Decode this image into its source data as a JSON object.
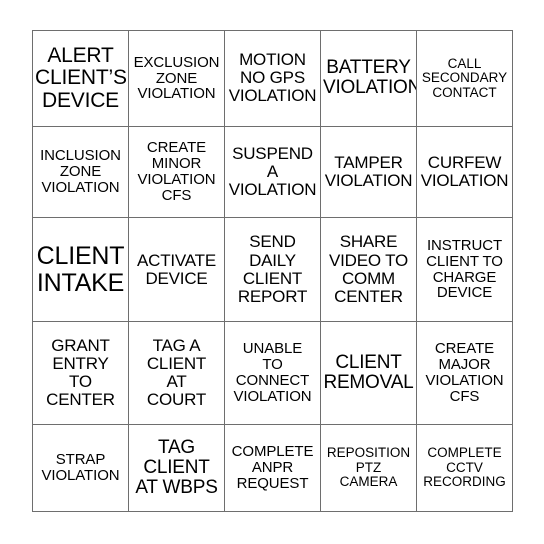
{
  "card": {
    "type": "bingo-card",
    "rows": 5,
    "columns": 5,
    "border_color": "#6e6e6e",
    "background_color": "#ffffff",
    "text_color": "#000000",
    "cells": [
      [
        {
          "text": "ALERT\nCLIENT’S\nDEVICE",
          "size": "xl"
        },
        {
          "text": "EXCLUSION\nZONE\nVIOLATION",
          "size": "s"
        },
        {
          "text": "MOTION\nNO GPS\nVIOLATION",
          "size": "m"
        },
        {
          "text": "BATTERY\nVIOLATION",
          "size": "l"
        },
        {
          "text": "CALL\nSECONDARY\nCONTACT",
          "size": "xs"
        }
      ],
      [
        {
          "text": "INCLUSION\nZONE\nVIOLATION",
          "size": "s"
        },
        {
          "text": "CREATE\nMINOR\nVIOLATION\nCFS",
          "size": "s"
        },
        {
          "text": "SUSPEND\nA\nVIOLATION",
          "size": "m"
        },
        {
          "text": "TAMPER\nVIOLATION",
          "size": "m"
        },
        {
          "text": "CURFEW\nVIOLATION",
          "size": "m"
        }
      ],
      [
        {
          "text": "CLIENT\nINTAKE",
          "size": "xxl"
        },
        {
          "text": "ACTIVATE\nDEVICE",
          "size": "m"
        },
        {
          "text": "SEND\nDAILY\nCLIENT\nREPORT",
          "size": "m"
        },
        {
          "text": "SHARE\nVIDEO TO\nCOMM\nCENTER",
          "size": "m"
        },
        {
          "text": "INSTRUCT\nCLIENT TO\nCHARGE\nDEVICE",
          "size": "s"
        }
      ],
      [
        {
          "text": "GRANT\nENTRY\nTO\nCENTER",
          "size": "m"
        },
        {
          "text": "TAG A\nCLIENT\nAT\nCOURT",
          "size": "m"
        },
        {
          "text": "UNABLE\nTO\nCONNECT\nVIOLATION",
          "size": "s"
        },
        {
          "text": "CLIENT\nREMOVAL",
          "size": "l"
        },
        {
          "text": "CREATE\nMAJOR\nVIOLATION\nCFS",
          "size": "s"
        }
      ],
      [
        {
          "text": "STRAP\nVIOLATION",
          "size": "s"
        },
        {
          "text": "TAG\nCLIENT\nAT WBPS",
          "size": "l"
        },
        {
          "text": "COMPLETE\nANPR\nREQUEST",
          "size": "s"
        },
        {
          "text": "REPOSITION\nPTZ\nCAMERA",
          "size": "xs"
        },
        {
          "text": "COMPLETE\nCCTV\nRECORDING",
          "size": "xs"
        }
      ]
    ]
  }
}
